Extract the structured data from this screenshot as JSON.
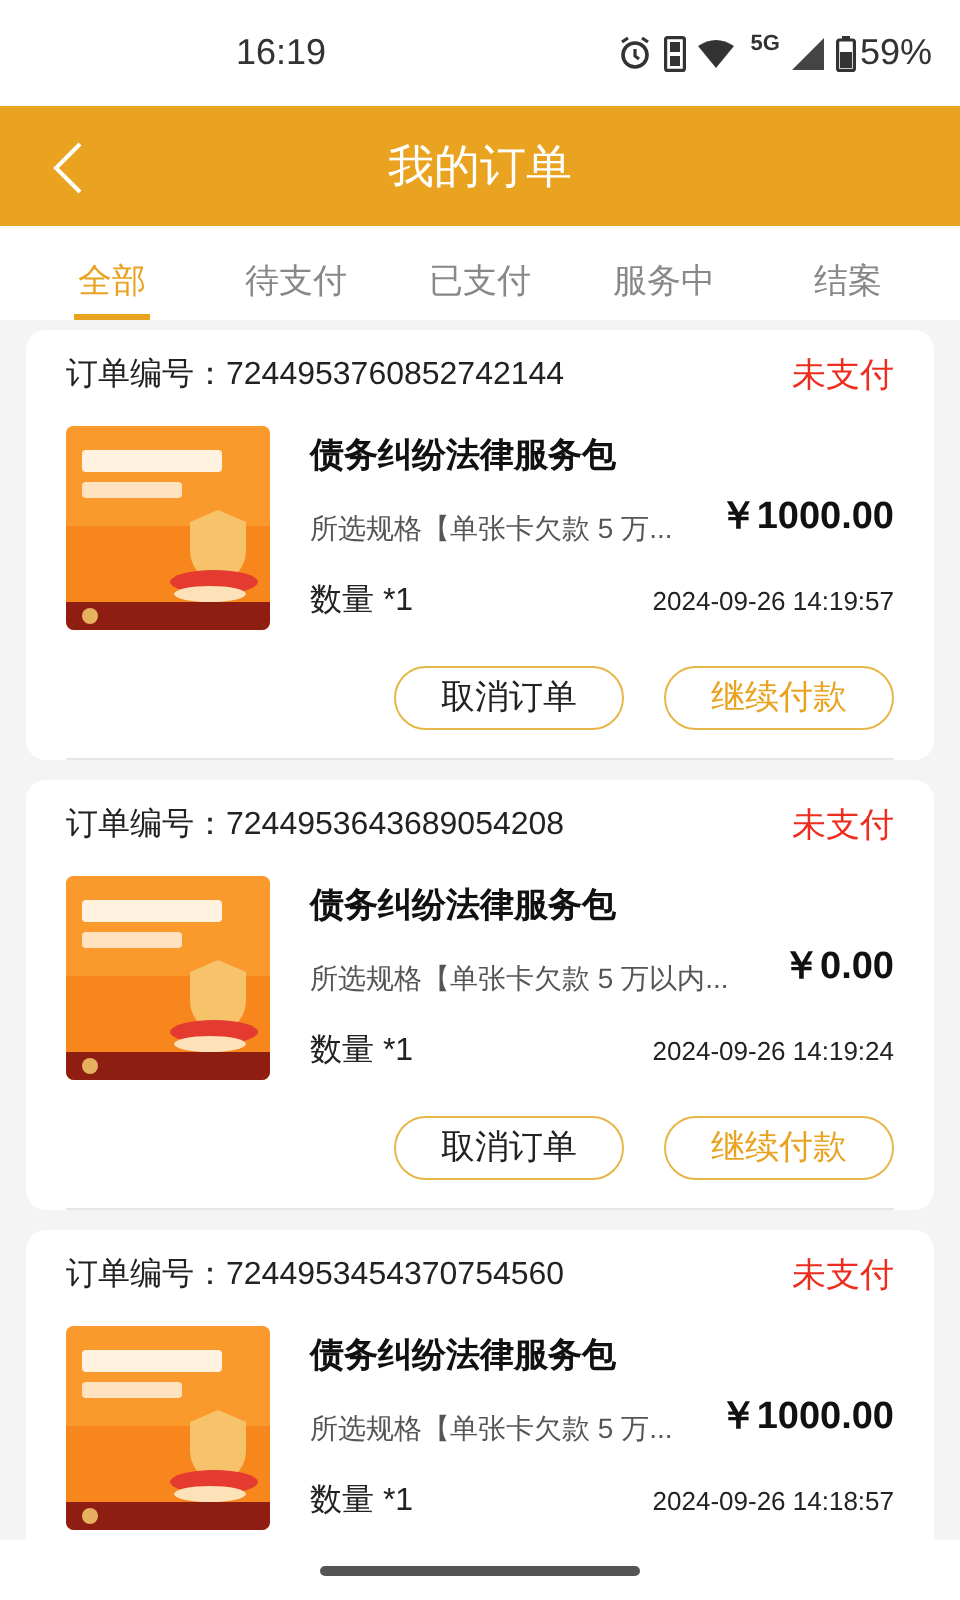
{
  "status_bar": {
    "time": "16:19",
    "network": "5G",
    "battery": "59%"
  },
  "header": {
    "title": "我的订单"
  },
  "tabs": [
    {
      "label": "全部",
      "selected": true
    },
    {
      "label": "待支付",
      "selected": false
    },
    {
      "label": "已支付",
      "selected": false
    },
    {
      "label": "服务中",
      "selected": false
    },
    {
      "label": "结案",
      "selected": false
    }
  ],
  "orders": [
    {
      "order_label": "订单编号：",
      "order_no": "7244953760852742144",
      "status": "未支付",
      "title": "债务纠纷法律服务包",
      "spec": "所选规格【单张卡欠款 5 万...",
      "price": "￥1000.00",
      "quantity": "数量 *1",
      "date": "2024-09-26 14:19:57",
      "buttons": [
        {
          "label": "取消订单",
          "kind": "outline"
        },
        {
          "label": "继续付款",
          "kind": "primary"
        }
      ]
    },
    {
      "order_label": "订单编号：",
      "order_no": "7244953643689054208",
      "status": "未支付",
      "title": "债务纠纷法律服务包",
      "spec": "所选规格【单张卡欠款 5 万以内...",
      "price": "￥0.00",
      "quantity": "数量 *1",
      "date": "2024-09-26 14:19:24",
      "buttons": [
        {
          "label": "取消订单",
          "kind": "outline"
        },
        {
          "label": "继续付款",
          "kind": "primary"
        }
      ]
    },
    {
      "order_label": "订单编号：",
      "order_no": "7244953454370754560",
      "status": "未支付",
      "title": "债务纠纷法律服务包",
      "spec": "所选规格【单张卡欠款 5 万...",
      "price": "￥1000.00",
      "quantity": "数量 *1",
      "date": "2024-09-26 14:18:57"
    }
  ]
}
